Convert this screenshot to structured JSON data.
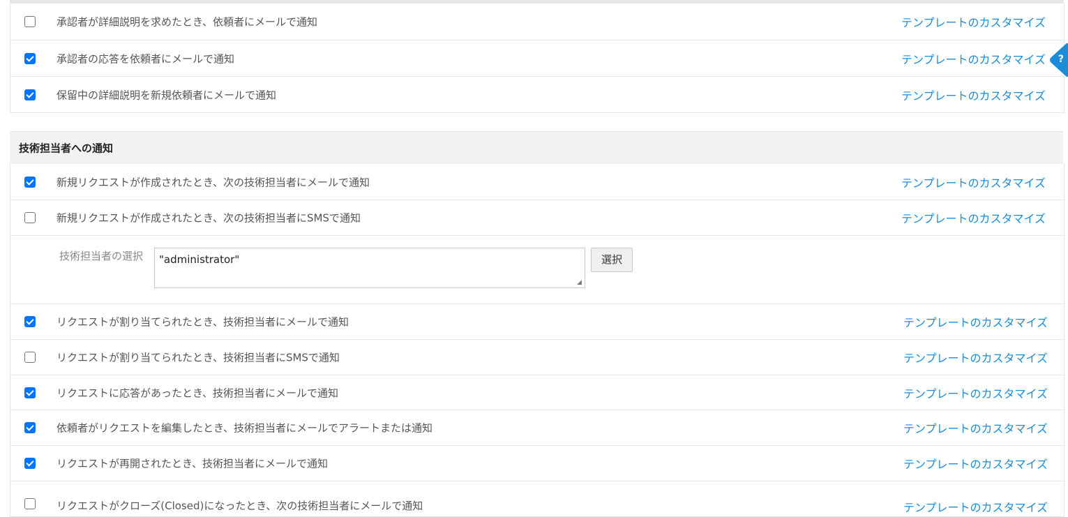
{
  "approval_rows": [
    {
      "label": "承認者が詳細説明を求めたとき、依頼者にメールで通知",
      "checked": false,
      "link": "テンプレートのカスタマイズ"
    },
    {
      "label": "承認者の応答を依頼者にメールで通知",
      "checked": true,
      "link": "テンプレートのカスタマイズ"
    },
    {
      "label": "保留中の詳細説明を新規依頼者にメールで通知",
      "checked": true,
      "link": "テンプレートのカスタマイズ"
    }
  ],
  "tech_section": {
    "title": "技術担当者への通知",
    "rows_top": [
      {
        "label": "新規リクエストが作成されたとき、次の技術担当者にメールで通知",
        "checked": true,
        "link": "テンプレートのカスタマイズ"
      },
      {
        "label": "新規リクエストが作成されたとき、次の技術担当者にSMSで通知",
        "checked": false,
        "link": "テンプレートのカスタマイズ"
      }
    ],
    "technician_picker": {
      "label": "技術担当者の選択",
      "value": "\"administrator\"",
      "button": "選択"
    },
    "rows_bottom": [
      {
        "label": "リクエストが割り当てられたとき、技術担当者にメールで通知",
        "checked": true,
        "link": "テンプレートのカスタマイズ"
      },
      {
        "label": "リクエストが割り当てられたとき、技術担当者にSMSで通知",
        "checked": false,
        "link": "テンプレートのカスタマイズ"
      },
      {
        "label": "リクエストに応答があったとき、技術担当者にメールで通知",
        "checked": true,
        "link": "テンプレートのカスタマイズ"
      },
      {
        "label": "依頼者がリクエストを編集したとき、技術担当者にメールでアラートまたは通知",
        "checked": true,
        "link": "テンプレートのカスタマイズ"
      },
      {
        "label": "リクエストが再開されたとき、技術担当者にメールで通知",
        "checked": true,
        "link": "テンプレートのカスタマイズ"
      },
      {
        "label": "リクエストがクローズ(Closed)になったとき、次の技術担当者にメールで通知",
        "checked": false,
        "link": "テンプレートのカスタマイズ"
      }
    ]
  },
  "help_tab": {
    "glyph": "?",
    "icon": "help-icon",
    "color": "#1a8cd8"
  },
  "colors": {
    "link": "#1a8cd8",
    "checkbox_checked": "#0075ff",
    "section_header_bg": "#f2f2f2"
  }
}
